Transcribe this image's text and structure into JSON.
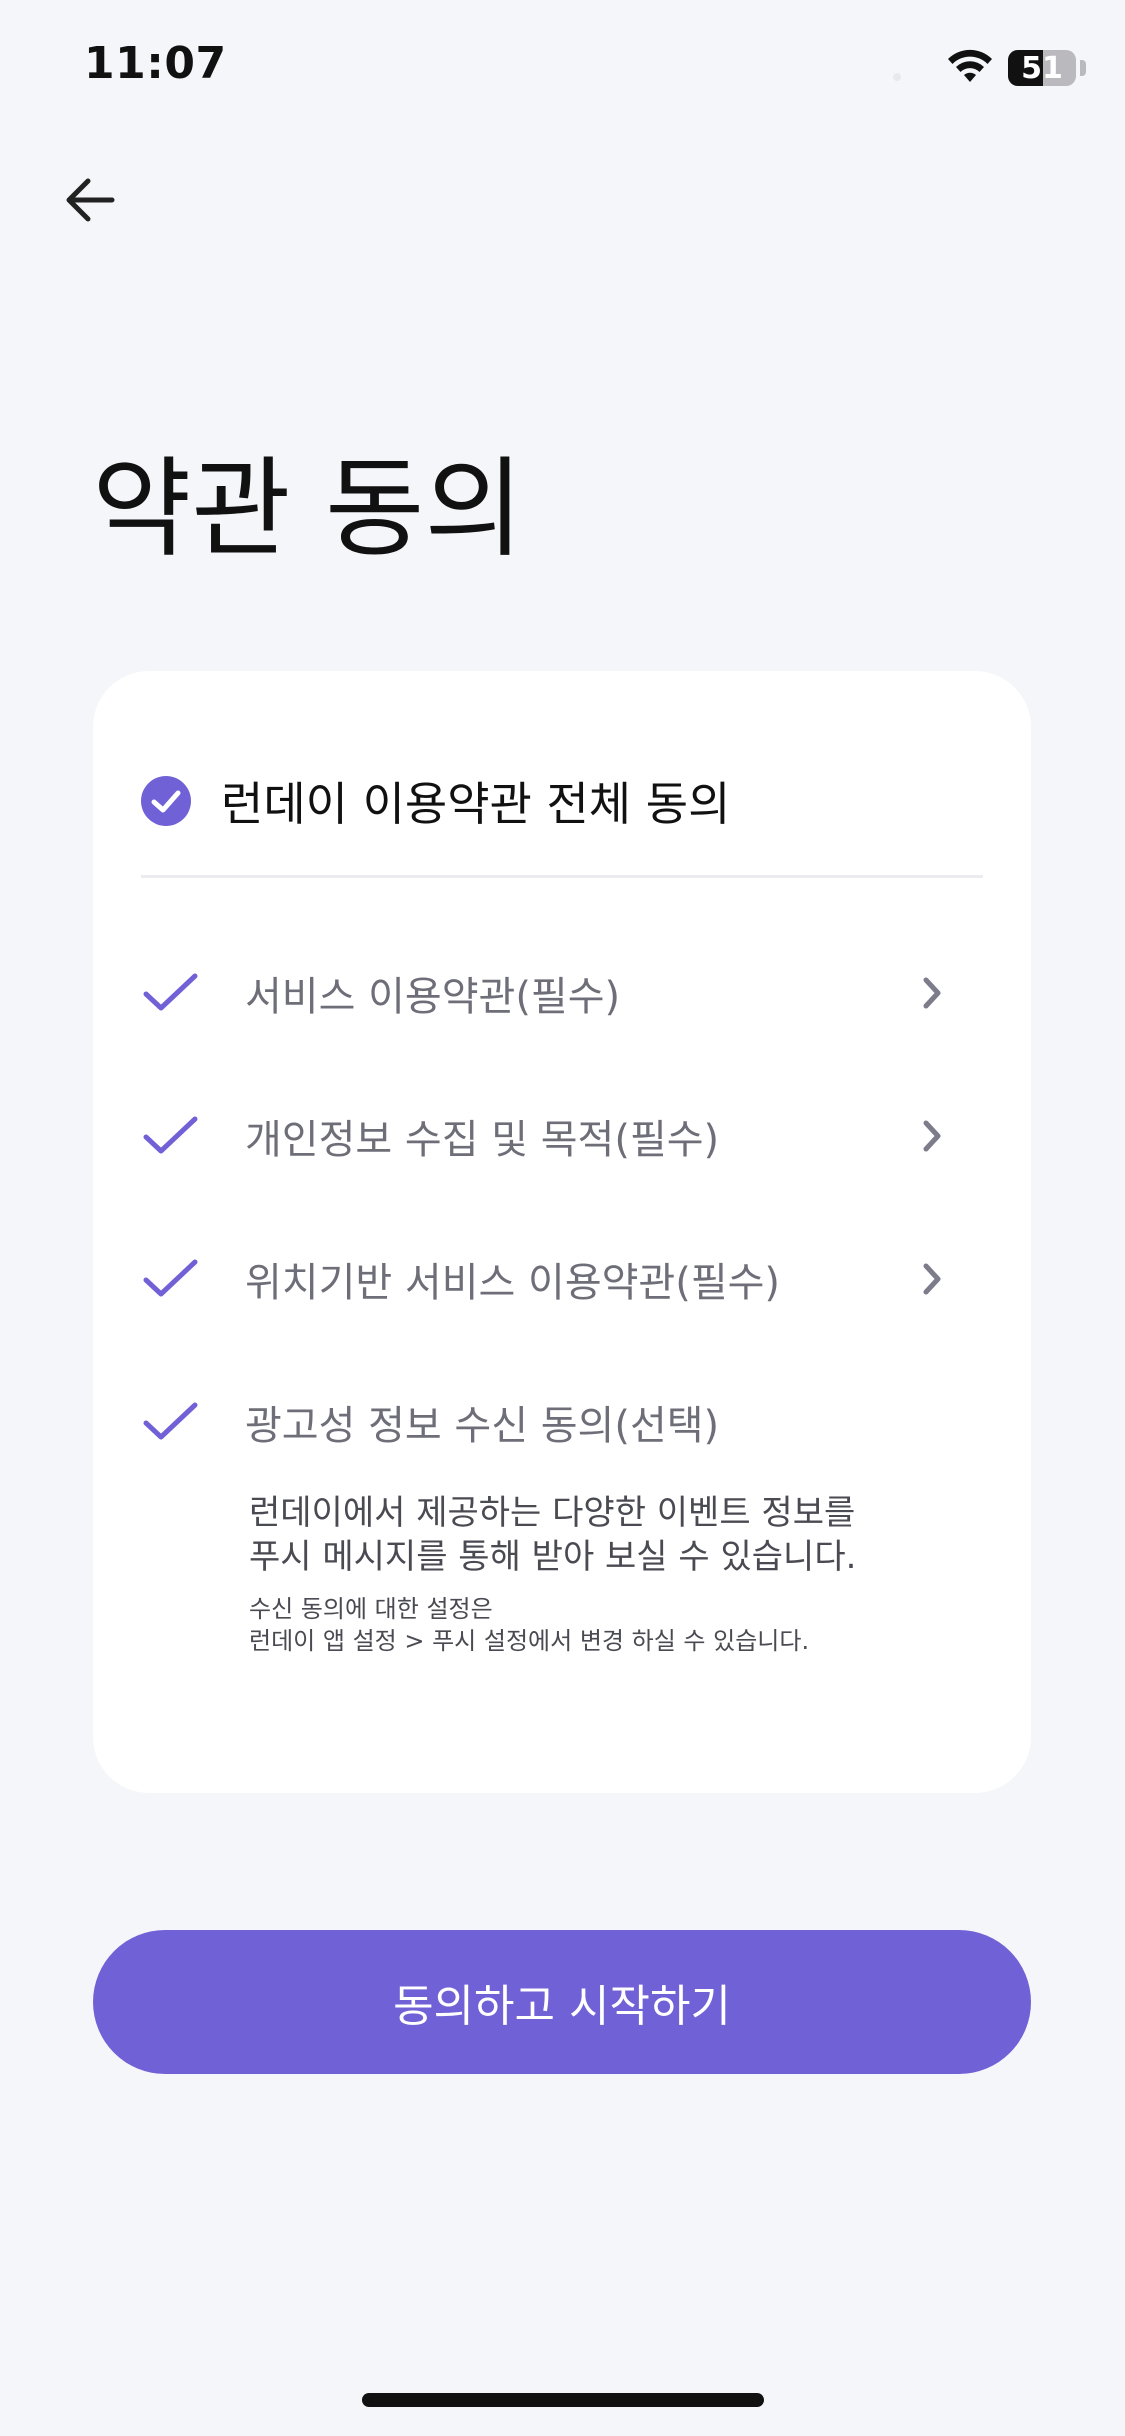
{
  "status_bar": {
    "time": "11:07",
    "battery_level": "51",
    "battery_fraction": 0.51
  },
  "header": {
    "back_icon": "arrow-left-icon",
    "title": "약관 동의"
  },
  "terms": {
    "all_agree_label": "런데이 이용약관 전체 동의",
    "all_agree_checked": true,
    "items": [
      {
        "label": "서비스 이용약관(필수)",
        "checked": true,
        "has_detail": true
      },
      {
        "label": "개인정보 수집 및 목적(필수)",
        "checked": true,
        "has_detail": true
      },
      {
        "label": "위치기반 서비스 이용약관(필수)",
        "checked": true,
        "has_detail": true
      },
      {
        "label": "광고성 정보 수신 동의(선택)",
        "checked": true,
        "has_detail": false
      }
    ],
    "marketing_description_line1": "런데이에서 제공하는 다양한 이벤트 정보를",
    "marketing_description_line2": "푸시 메시지를 통해 받아 보실 수 있습니다.",
    "marketing_note_line1": "수신 동의에 대한 설정은",
    "marketing_note_line2": "런데이 앱 설정 > 푸시 설정에서 변경 하실 수 있습니다."
  },
  "actions": {
    "start_label": "동의하고 시작하기"
  },
  "colors": {
    "accent": "#7161D6",
    "background": "#F5F6FA",
    "card": "#FFFFFF",
    "secondary_text": "#6E6E78",
    "chevron": "#7C7C8A"
  }
}
